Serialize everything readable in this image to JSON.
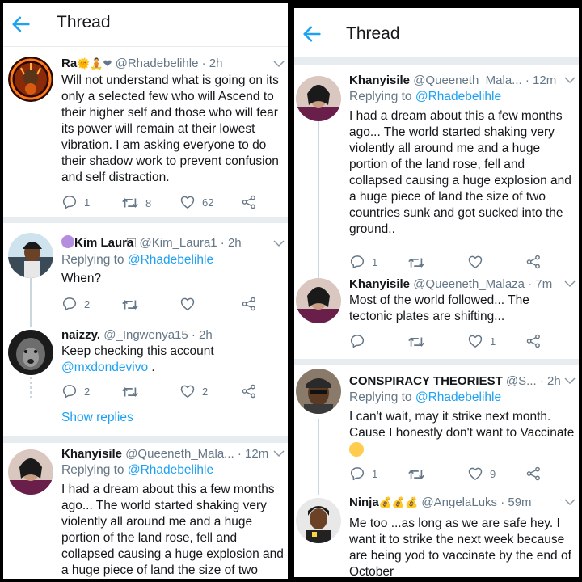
{
  "left": {
    "header": {
      "title": "Thread"
    },
    "show_replies": "Show replies",
    "tweets": [
      {
        "name": "Ra",
        "name_emoji": "🌞🧘❤",
        "handle": "@Rhadebelihle · 2h",
        "text": "Will not understand what is going on its only a selected few who will Ascend to their higher self and those who will fear its power will remain at their lowest vibration. I am asking everyone to do their shadow work to prevent confusion and self distraction.",
        "reply_count": "1",
        "retweet_count": "8",
        "like_count": "62"
      },
      {
        "name_prefix_emoji": "🟣",
        "name": "Kim Laura",
        "name_suffix": "⃞",
        "handle": "@Kim_Laura1 · 2h",
        "replying_label": "Replying to",
        "replying_to": "@Rhadebelihle",
        "text": "When?",
        "reply_count": "2",
        "retweet_count": "",
        "like_count": ""
      },
      {
        "name": "naizzy.",
        "handle": "@_Ingwenya15 · 2h",
        "text": "Keep checking this account",
        "mention": "@mxdondevivo",
        "text_after": " .",
        "reply_count": "2",
        "retweet_count": "",
        "like_count": "2"
      },
      {
        "name": "Khanyisile",
        "handle": "@Queeneth_Mala... · 12m",
        "replying_label": "Replying to",
        "replying_to": "@Rhadebelihle",
        "text": "I had a dream about this a few months ago... The world started shaking very violently all around me and a huge portion of the land rose, fell and collapsed causing a huge explosion and a huge piece of land the size of two"
      }
    ]
  },
  "right": {
    "header": {
      "title": "Thread"
    },
    "tweets": [
      {
        "name": "Khanyisile",
        "handle": "@Queeneth_Mala... · 12m",
        "replying_label": "Replying to",
        "replying_to": "@Rhadebelihle",
        "text": "I had a dream about this a few months ago... The world started shaking very violently all around me and a huge portion of the land rose, fell and collapsed causing a huge explosion and a huge piece of land the size of two countries sunk and got sucked into the ground..",
        "reply_count": "1",
        "retweet_count": "",
        "like_count": ""
      },
      {
        "name": "Khanyisile",
        "handle": "@Queeneth_Malaza · 7m",
        "text": "Most of the world followed... The tectonic plates are shifting...",
        "reply_count": "",
        "retweet_count": "",
        "like_count": "1"
      },
      {
        "name": "CONSPIRACY THEORIEST",
        "handle": "@S... · 2h",
        "replying_label": "Replying to",
        "replying_to": "@Rhadebelihle",
        "text": "I can't wait, may it strike next month. Cause I honestly don't want to Vaccinate",
        "text_emoji": "😮",
        "reply_count": "1",
        "retweet_count": "",
        "like_count": "9"
      },
      {
        "name": "Ninja",
        "name_emoji": "💰💰💰",
        "handle": "@AngelaLuks · 59m",
        "text": "Me too ...as long as we are safe hey.  I want it to strike the next week because are being yod to vaccinate by the end of October"
      }
    ]
  },
  "colors": {
    "accent": "#1da1f2",
    "muted": "#657786",
    "text": "#14171a",
    "divider": "#e6ecf0"
  },
  "icons": [
    "back-arrow-icon",
    "chevron-down-icon",
    "reply-icon",
    "retweet-icon",
    "like-icon",
    "share-icon"
  ]
}
